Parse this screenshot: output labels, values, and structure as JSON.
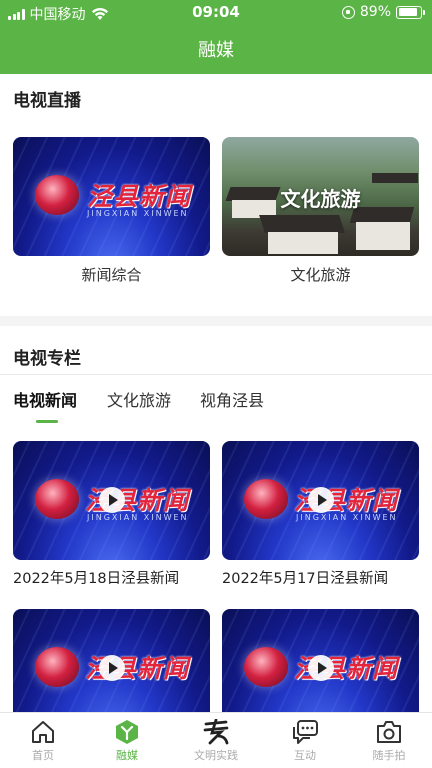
{
  "status_bar": {
    "carrier": "中国移动",
    "time": "09:04",
    "battery_percent": "89%",
    "battery_level": 0.89
  },
  "header": {
    "title": "融媒"
  },
  "live": {
    "title": "电视直播",
    "channels": [
      {
        "label": "新闻综合",
        "brand": "泾县新闻",
        "brand_sub": "JINGXIAN XINWEN"
      },
      {
        "label": "文化旅游",
        "overlay": "文化旅游"
      }
    ]
  },
  "columns": {
    "title": "电视专栏",
    "tabs": [
      {
        "label": "电视新闻",
        "active": true
      },
      {
        "label": "文化旅游",
        "active": false
      },
      {
        "label": "视角泾县",
        "active": false
      }
    ],
    "videos": [
      {
        "label": "2022年5月18日泾县新闻",
        "brand": "泾县新闻",
        "brand_sub": "JINGXIAN XINWEN"
      },
      {
        "label": "2022年5月17日泾县新闻",
        "brand": "泾县新闻",
        "brand_sub": "JINGXIAN XINWEN"
      },
      {
        "label": "",
        "brand": "泾县新闻",
        "brand_sub": ""
      },
      {
        "label": "",
        "brand": "泾县新闻",
        "brand_sub": ""
      }
    ]
  },
  "nav": {
    "items": [
      {
        "label": "首页",
        "icon": "home-icon",
        "active": false
      },
      {
        "label": "融媒",
        "icon": "media-icon",
        "active": true
      },
      {
        "label": "文明实践",
        "icon": "civilization-icon",
        "active": false
      },
      {
        "label": "互动",
        "icon": "chat-icon",
        "active": false
      },
      {
        "label": "随手拍",
        "icon": "camera-icon",
        "active": false
      }
    ],
    "active_color": "#5bb446"
  },
  "colors": {
    "brand_green": "#5bb446"
  }
}
